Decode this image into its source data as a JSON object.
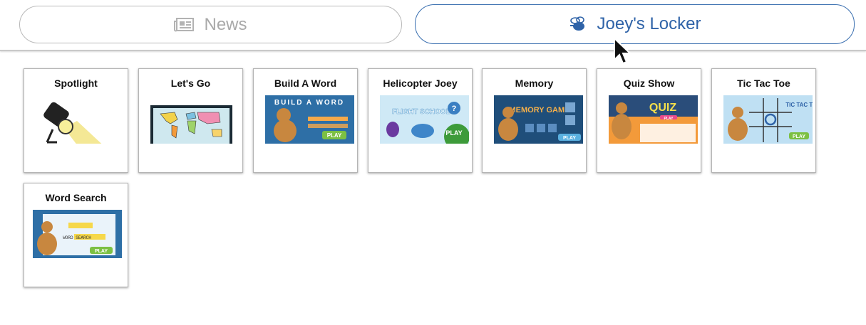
{
  "tabs": {
    "news": {
      "label": "News",
      "icon": "newspaper-icon"
    },
    "locker": {
      "label": "Joey's Locker",
      "icon": "bee-icon",
      "active": true
    }
  },
  "games": [
    {
      "title": "Spotlight"
    },
    {
      "title": "Let's Go"
    },
    {
      "title": "Build A Word",
      "thumb_text": "BUILD A WORD",
      "play": "PLAY"
    },
    {
      "title": "Helicopter Joey",
      "thumb_text": "FLIGHT SCHOOL",
      "play": "PLAY"
    },
    {
      "title": "Memory",
      "thumb_text": "MEMORY GAME",
      "play": "PLAY"
    },
    {
      "title": "Quiz Show",
      "thumb_text": "QUIZ",
      "play": "PLAY"
    },
    {
      "title": "Tic Tac Toe",
      "thumb_text": "TIC TAC TOE",
      "play": "PLAY"
    },
    {
      "title": "Word Search",
      "thumb_text": "WORD SEARCH",
      "play": "PLAY"
    }
  ],
  "colors": {
    "accent": "#2f63a8",
    "inactive_text": "#a9a9a9"
  }
}
